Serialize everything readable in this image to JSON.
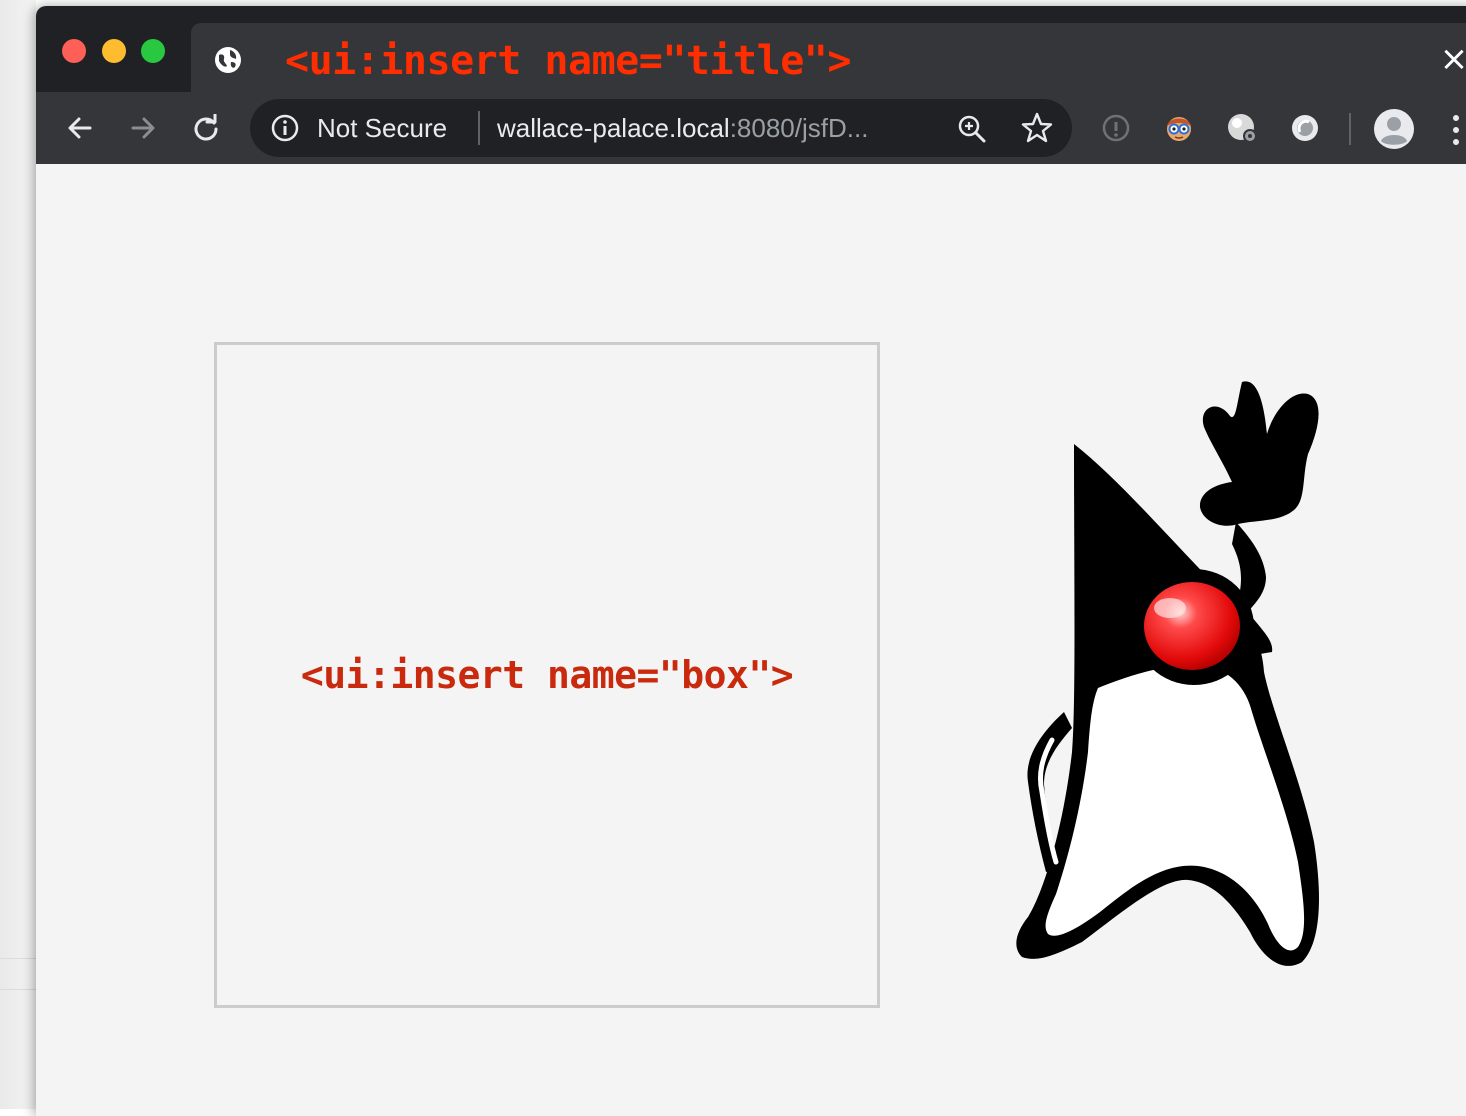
{
  "browser": {
    "tab_title": "<ui:insert name=\"title\">",
    "close_glyph": "×",
    "favicon_icon": "globe-icon",
    "nav": {
      "back_icon": "arrow-left-icon",
      "forward_icon": "arrow-right-icon",
      "reload_icon": "reload-icon"
    },
    "address_bar": {
      "security_text": "Not Secure",
      "url_host": "wallace-palace.local",
      "url_rest": ":8080/jsfD..."
    },
    "colors": {
      "title_text": "#ff2d00",
      "chrome_dark": "#202124",
      "toolbar": "#35363a"
    }
  },
  "page": {
    "box_label": "<ui:insert name=\"box\">",
    "box_label_color": "#c92a0e",
    "background": "#f4f4f4",
    "mascot_icon": "duke-mascot"
  }
}
